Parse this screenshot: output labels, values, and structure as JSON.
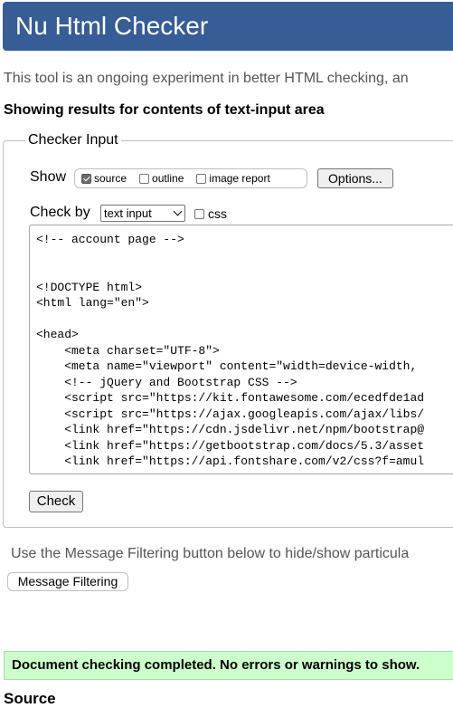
{
  "header": {
    "title": "Nu Html Checker"
  },
  "intro": "This tool is an ongoing experiment in better HTML checking, an",
  "results_for": "Showing results for contents of text-input area",
  "checker_input": {
    "legend": "Checker Input",
    "show_label": "Show",
    "show_options": {
      "source": {
        "label": "source",
        "checked": true
      },
      "outline": {
        "label": "outline",
        "checked": false
      },
      "image_report": {
        "label": "image report",
        "checked": false
      }
    },
    "options_button": "Options...",
    "check_by_label": "Check by",
    "check_by_value": "text input",
    "css_label": "css",
    "css_checked": false,
    "source_text": "<!-- account page -->\n\n\n<!DOCTYPE html>\n<html lang=\"en\">\n\n<head>\n    <meta charset=\"UTF-8\">\n    <meta name=\"viewport\" content=\"width=device-width,\n    <!-- jQuery and Bootstrap CSS -->\n    <script src=\"https://kit.fontawesome.com/ecedfde1ad\n    <script src=\"https://ajax.googleapis.com/ajax/libs/\n    <link href=\"https://cdn.jsdelivr.net/npm/bootstrap@\n    <link href=\"https://getbootstrap.com/docs/5.3/asset\n    <link href=\"https://api.fontshare.com/v2/css?f=amul",
    "check_button": "Check"
  },
  "filtering": {
    "text": "Use the Message Filtering button below to hide/show particula",
    "button": "Message Filtering"
  },
  "success_message": "Document checking completed. No errors or warnings to show.",
  "source_heading": "Source",
  "colors": {
    "header_bg": "#365d95",
    "success_bg": "#ccffcc"
  }
}
